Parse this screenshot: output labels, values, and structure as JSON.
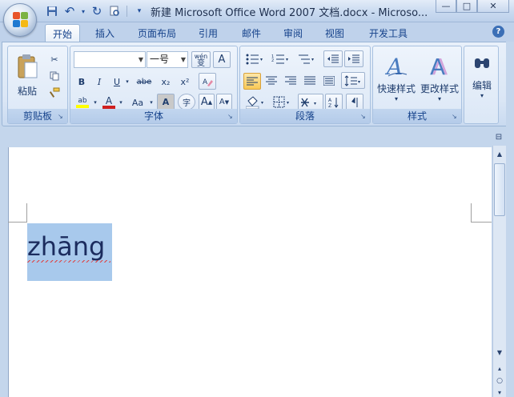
{
  "window": {
    "title": "新建 Microsoft Office Word 2007 文档.docx - Microso...",
    "buttons": {
      "minimize": "—",
      "maximize": "□",
      "close": "✕"
    }
  },
  "quick_access": [
    {
      "name": "save-icon",
      "glyph": "💾"
    },
    {
      "name": "undo-icon",
      "glyph": "↶"
    },
    {
      "name": "redo-icon",
      "glyph": "↻"
    },
    {
      "name": "print-preview-icon",
      "glyph": "🖨"
    },
    {
      "name": "customize-icon",
      "glyph": "▾"
    }
  ],
  "tabs": [
    {
      "label": "开始",
      "active": true
    },
    {
      "label": "插入"
    },
    {
      "label": "页面布局"
    },
    {
      "label": "引用"
    },
    {
      "label": "邮件"
    },
    {
      "label": "审阅"
    },
    {
      "label": "视图"
    },
    {
      "label": "开发工具"
    }
  ],
  "ribbon": {
    "clipboard": {
      "label": "剪贴板",
      "paste": "粘贴"
    },
    "font": {
      "label": "字体",
      "font_name": "",
      "font_size": "一号",
      "wen": "wén",
      "wen_char": "变",
      "bold": "B",
      "italic": "I",
      "underline": "U",
      "strike": "abe",
      "subscript": "x₂",
      "superscript": "x²",
      "highlight": "ab",
      "font_color": "A",
      "change_case": "Aa",
      "grow": "A",
      "shrink": "A",
      "char_shading": "A",
      "enclose": "字"
    },
    "paragraph": {
      "label": "段落"
    },
    "styles": {
      "label": "样式",
      "quick_styles": "快速样式",
      "change_styles": "更改样式"
    },
    "editing": {
      "label": "编辑"
    }
  },
  "document": {
    "text": "zhāng"
  },
  "colors": {
    "ribbon_bg": "#dae6f5",
    "selection": "#a8c9ec",
    "accent": "#15428b",
    "highlight_yellow": "#ffff00",
    "font_red": "#d02020"
  }
}
